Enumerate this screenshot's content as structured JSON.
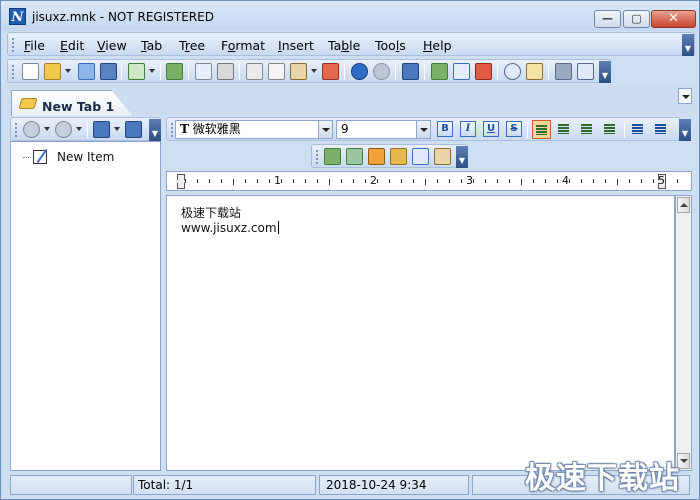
{
  "window": {
    "title": "jisuxz.mnk - NOT REGISTERED",
    "app_icon_letter": "N",
    "minimize_glyph": "—",
    "maximize_glyph": "▢",
    "close_glyph": "✕"
  },
  "menu": {
    "items": [
      {
        "label": "File",
        "accel": "F"
      },
      {
        "label": "Edit",
        "accel": "E"
      },
      {
        "label": "View",
        "accel": "V"
      },
      {
        "label": "Tab",
        "accel": "T"
      },
      {
        "label": "Tree",
        "accel": "r"
      },
      {
        "label": "Format",
        "accel": "o"
      },
      {
        "label": "Insert",
        "accel": "I"
      },
      {
        "label": "Table",
        "accel": "b"
      },
      {
        "label": "Tools",
        "accel": "l"
      },
      {
        "label": "Help",
        "accel": "H"
      }
    ]
  },
  "tabs": [
    {
      "label": "New Tab 1"
    }
  ],
  "tree": {
    "items": [
      {
        "label": "New Item"
      }
    ]
  },
  "format_toolbar": {
    "font_name": "微软雅黑",
    "font_glyph": "T",
    "font_size": "9",
    "bold": "B",
    "italic": "I",
    "underline": "U",
    "strike": "S"
  },
  "ruler": {
    "numbers": [
      "1",
      "2",
      "3",
      "4",
      "5"
    ]
  },
  "editor": {
    "lines": [
      "极速下载站",
      "www.jisuxz.com"
    ]
  },
  "status": {
    "total": "Total: 1/1",
    "timestamp": "2018-10-24 9:34"
  },
  "watermark": {
    "text": "极速下载站"
  },
  "colors": {
    "chrome": "#cfdff2",
    "accent_blue": "#3a6dbd",
    "active_align": "#fbd29a"
  }
}
